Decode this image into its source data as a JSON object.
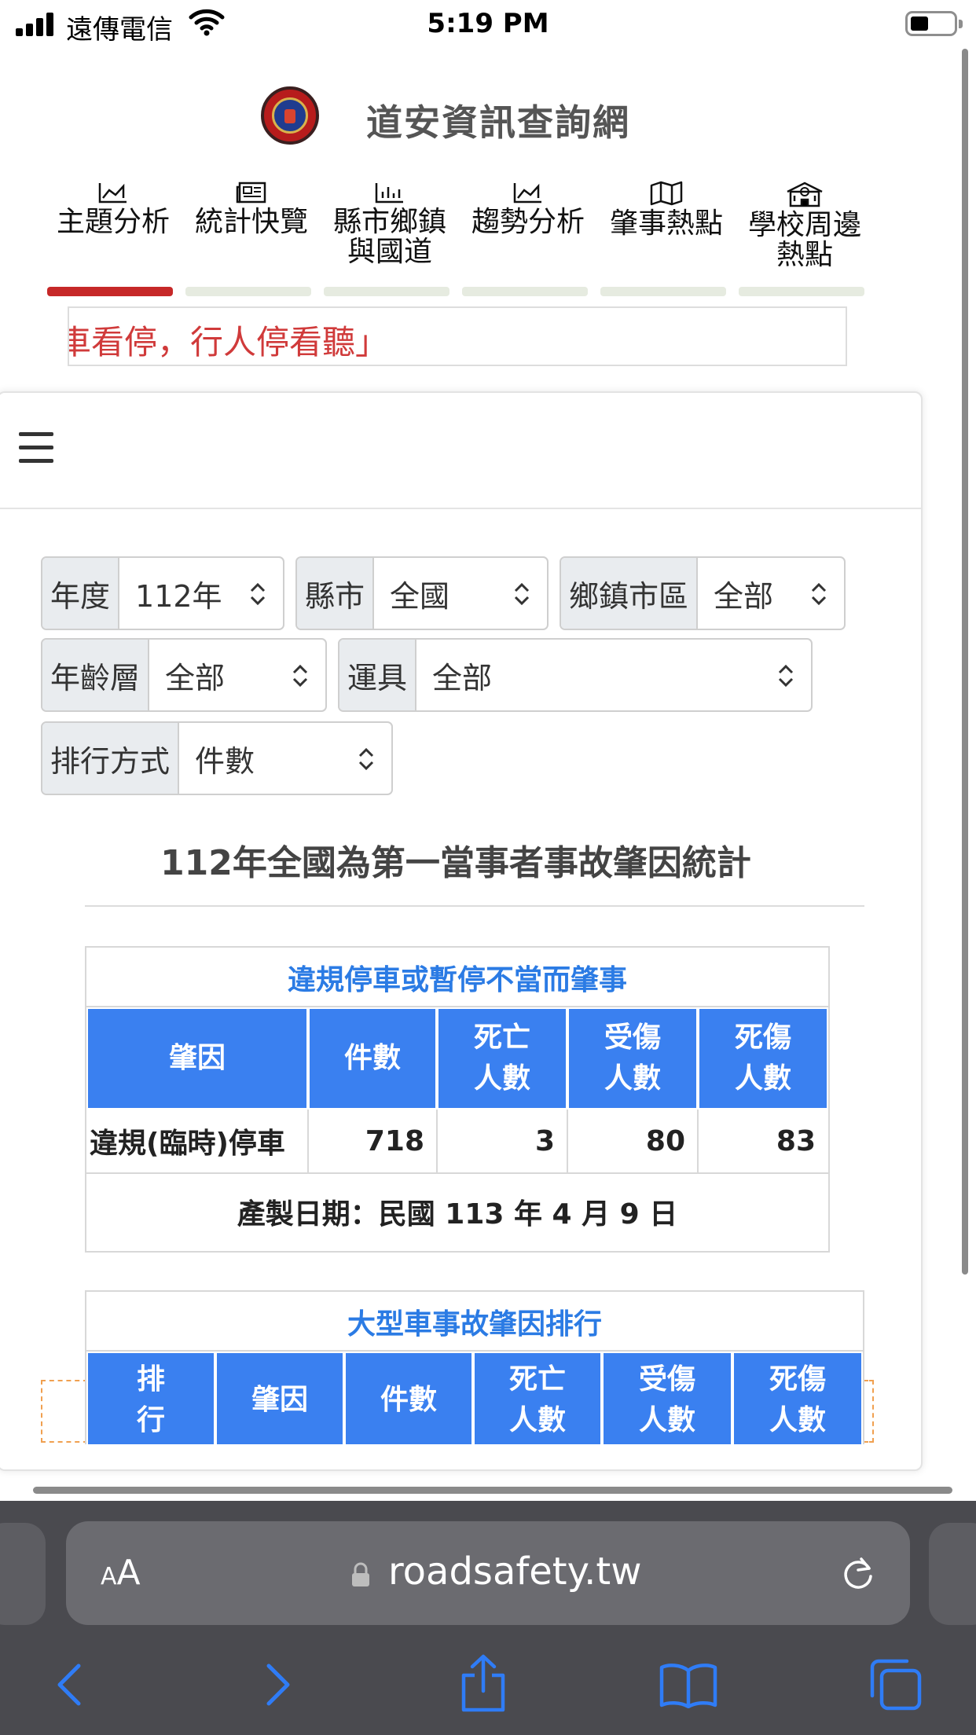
{
  "status_bar": {
    "carrier": "遠傳電信",
    "time": "5:19 PM"
  },
  "site": {
    "title": "道安資訊查詢網"
  },
  "nav": {
    "tabs": [
      {
        "label": "主題分析",
        "icon": "chart-area-icon",
        "active": true
      },
      {
        "label": "統計快覽",
        "icon": "newspaper-icon",
        "active": false
      },
      {
        "label": "縣市鄉鎮與國道",
        "icon": "bar-chart-icon",
        "active": false
      },
      {
        "label": "趨勢分析",
        "icon": "chart-area-icon",
        "active": false
      },
      {
        "label": "肇事熱點",
        "icon": "map-icon",
        "active": false
      },
      {
        "label": "學校周邊熱點",
        "icon": "school-icon",
        "active": false
      }
    ]
  },
  "marquee": {
    "text": "車看停，行人停看聽」"
  },
  "filters": {
    "year": {
      "label": "年度",
      "value": "112年"
    },
    "county": {
      "label": "縣市",
      "value": "全國"
    },
    "township": {
      "label": "鄉鎮市區",
      "value": "全部"
    },
    "age": {
      "label": "年齡層",
      "value": "全部"
    },
    "vehicle": {
      "label": "運具",
      "value": "全部"
    },
    "sort": {
      "label": "排行方式",
      "value": "件數"
    }
  },
  "report": {
    "title": "112年全國為第一當事者事故肇因統計"
  },
  "table1": {
    "caption": "違規停車或暫停不當而肇事",
    "headers": [
      "肇因",
      "件數",
      "死亡\n人數",
      "受傷\n人數",
      "死傷\n人數"
    ],
    "rows": [
      [
        "違規(臨時)停車",
        "718",
        "3",
        "80",
        "83"
      ]
    ],
    "footnote": "產製日期：民國 113 年 4 月 9 日"
  },
  "table2": {
    "caption": "大型車事故肇因排行",
    "headers": [
      "排\n行",
      "肇因",
      "件數",
      "死亡\n人數",
      "受傷\n人數",
      "死傷\n人數"
    ]
  },
  "browser": {
    "text_size_label": "AA",
    "url": "roadsafety.tw"
  },
  "colors": {
    "accent_red": "#c62828",
    "table_header_blue": "#3a80f0",
    "caption_blue": "#2b7be4"
  }
}
